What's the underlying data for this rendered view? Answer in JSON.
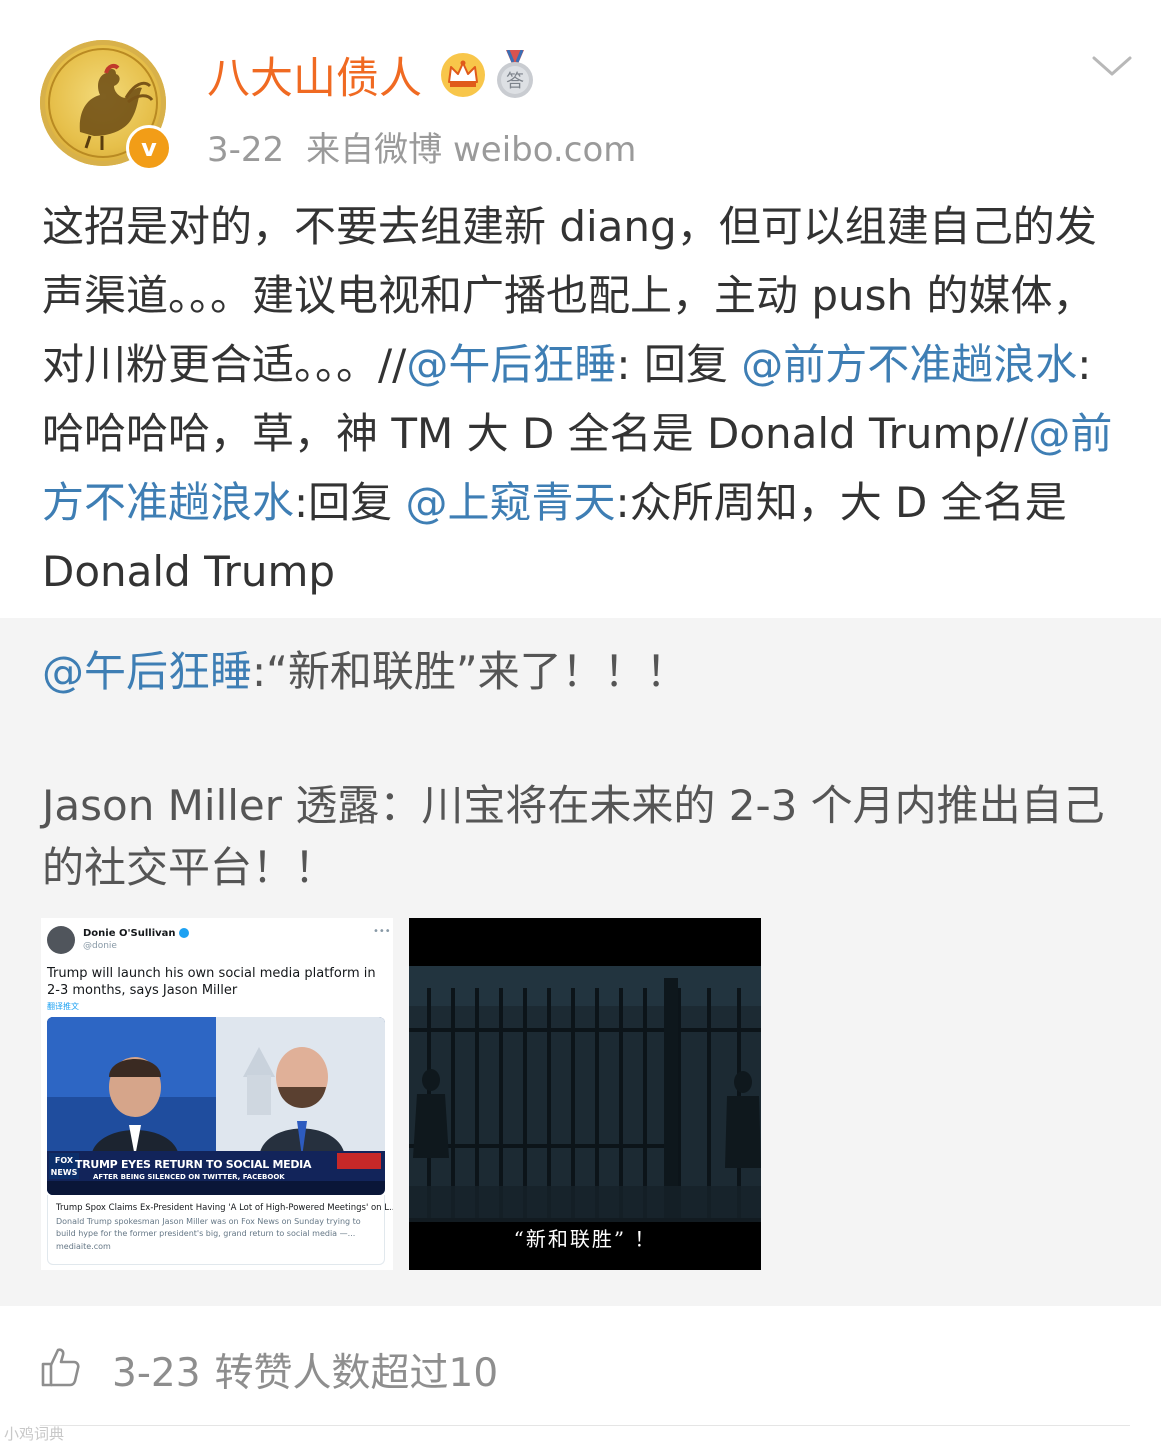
{
  "header": {
    "username": "八大山债人",
    "date": "3-22",
    "source": "来自微博 weibo.com",
    "medal_label": "答"
  },
  "post": {
    "p1": "这招是对的，不要去组建新 diang，但可以组建自己的发声渠道。。。建议电视和广播也配上，主动 push 的媒体，对川粉更合适。。。//",
    "m1": "@午后狂睡",
    "p2": ": 回复",
    "m2": "@前方不准趟浪水",
    "p3": ":哈哈哈哈，草，神 TM 大 D 全名是 Donald Trump//",
    "m3": "@前方不准趟浪水",
    "p4": ":回复",
    "m4": "@上窥青天",
    "p5": ":众所周知，大 D 全名是 Donald Trump"
  },
  "repost": {
    "mention": "@午后狂睡",
    "line1": ":“新和联胜”来了！！！",
    "body": "Jason Miller 透露：川宝将在未来的 2-3 个月内推出自己的社交平台！！"
  },
  "tweet": {
    "name": "Donie O'Sullivan",
    "handle": "@donie",
    "text": "Trump will launch his own social media platform in 2-3 months, says Jason Miller",
    "translate": "翻译推文",
    "chyron": "TRUMP EYES RETURN TO SOCIAL MEDIA",
    "chyron_sub": "AFTER BEING SILENCED ON TWITTER, FACEBOOK",
    "fox": "FOX NEWS",
    "card_title": "Trump Spox Claims Ex-President Having 'A Lot of High-Powered Meetings' on L...",
    "card_desc": "Donald Trump spokesman Jason Miller was on Fox News on Sunday trying to build hype for the former president's big, grand return to social media —...",
    "card_domain": "mediaite.com"
  },
  "movie": {
    "subtitle": "“新和联胜” ！"
  },
  "footer": {
    "date": "3-23",
    "text": "转赞人数超过10"
  },
  "watermark": "小鸡词典",
  "colors": {
    "username": "#f06a22",
    "mention": "#3e7eb4",
    "meta": "#9a9a9a",
    "repost_bg": "#f4f4f4",
    "verified_badge": "#f29d17"
  },
  "icons": [
    "chevron-down-icon",
    "crown-icon",
    "medal-icon",
    "thumbs-up-icon",
    "verified-icon"
  ]
}
